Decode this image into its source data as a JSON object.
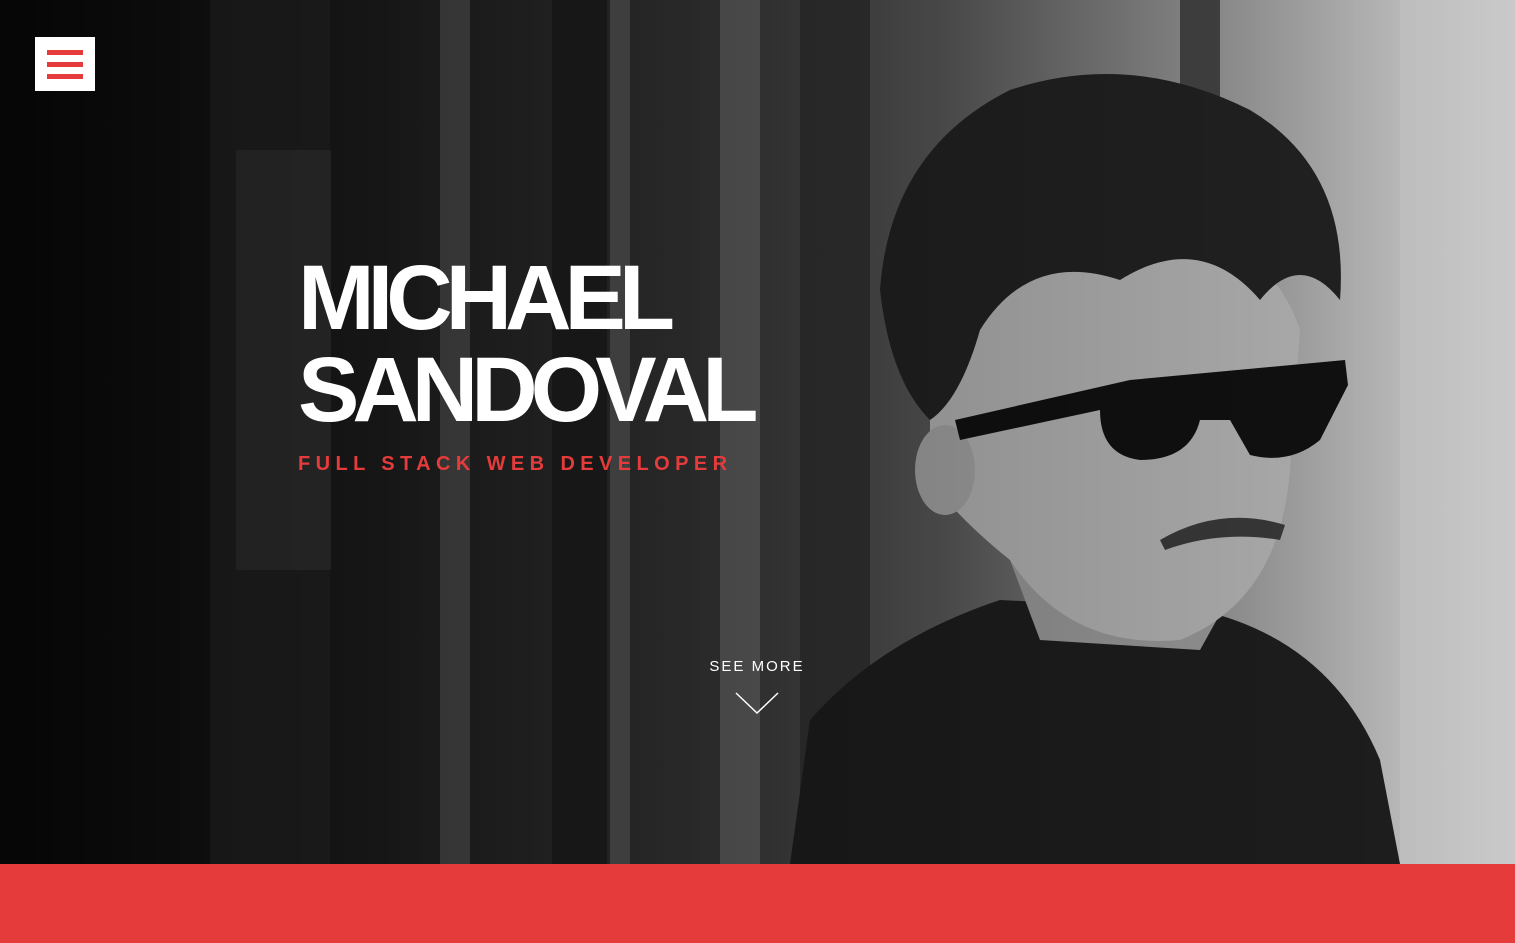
{
  "header": {
    "menu_icon": "hamburger-menu-icon"
  },
  "hero": {
    "name_line1": "MICHAEL",
    "name_line2": "SANDOVAL",
    "tagline": "FULL STACK WEB DEVELOPER",
    "see_more_label": "SEE MORE",
    "see_more_icon": "chevron-down-icon",
    "background": "black-and-white portrait photo"
  },
  "colors": {
    "accent": "#e63b3b",
    "text": "#ffffff"
  }
}
